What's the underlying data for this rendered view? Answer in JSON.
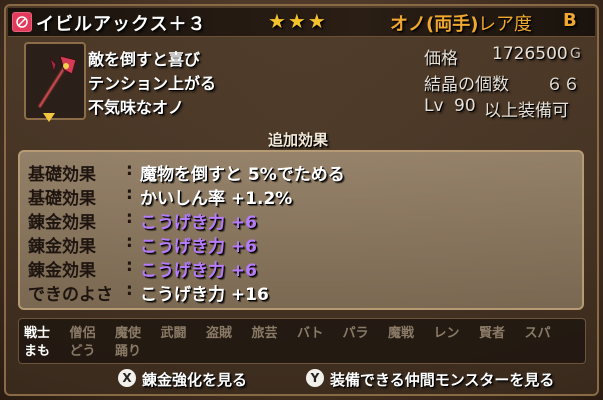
{
  "title_bar": {
    "item_name": "イビルアックス＋３",
    "stars": "★★★",
    "weapon_type": "オノ(両手)",
    "rarity_label": "レア度",
    "rarity_grade": "B"
  },
  "description": [
    "敵を倒すと喜び",
    "テンション上がる",
    "不気味なオノ"
  ],
  "stats": {
    "price_label": "価格",
    "price_value": "1726500",
    "price_unit": "G",
    "crystal_label": "結晶の個数",
    "crystal_value": "６６",
    "level_prefix": "Lv",
    "level_value": "90",
    "level_suffix": "以上装備可"
  },
  "effects": {
    "header": "追加効果",
    "rows": [
      {
        "label": "基礎効果",
        "value": "魔物を倒すと 5%でためる",
        "color": "white"
      },
      {
        "label": "基礎効果",
        "value": "かいしん率 +1.2%",
        "color": "white"
      },
      {
        "label": "錬金効果",
        "value": "こうげき力 +6",
        "color": "purple"
      },
      {
        "label": "錬金効果",
        "value": "こうげき力 +6",
        "color": "purple"
      },
      {
        "label": "錬金効果",
        "value": "こうげき力 +6",
        "color": "purple"
      },
      {
        "label": "できのよさ",
        "value": "こうげき力 +16",
        "color": "white"
      }
    ]
  },
  "jobs": {
    "row1": [
      {
        "name": "戦士",
        "enabled": true
      },
      {
        "name": "僧侶",
        "enabled": false
      },
      {
        "name": "魔使",
        "enabled": false
      },
      {
        "name": "武闘",
        "enabled": false
      },
      {
        "name": "盗賊",
        "enabled": false
      },
      {
        "name": "旅芸",
        "enabled": false
      },
      {
        "name": "バト",
        "enabled": false
      },
      {
        "name": "パラ",
        "enabled": false
      },
      {
        "name": "魔戦",
        "enabled": false
      },
      {
        "name": "レン",
        "enabled": false
      },
      {
        "name": "賢者",
        "enabled": false
      },
      {
        "name": "スパ",
        "enabled": false
      }
    ],
    "row2": [
      {
        "name": "まも",
        "enabled": true
      },
      {
        "name": "どう",
        "enabled": false
      },
      {
        "name": "踊り",
        "enabled": false
      }
    ]
  },
  "footer": {
    "x_button": "X",
    "x_label": "錬金強化を見る",
    "y_button": "Y",
    "y_label": "装備できる仲間モンスターを見る"
  },
  "colors": {
    "accent_orange": "#f0a830",
    "star_gold": "#f4c22b",
    "effect_purple": "#b77bff",
    "icon_pink": "#e23a5a"
  }
}
